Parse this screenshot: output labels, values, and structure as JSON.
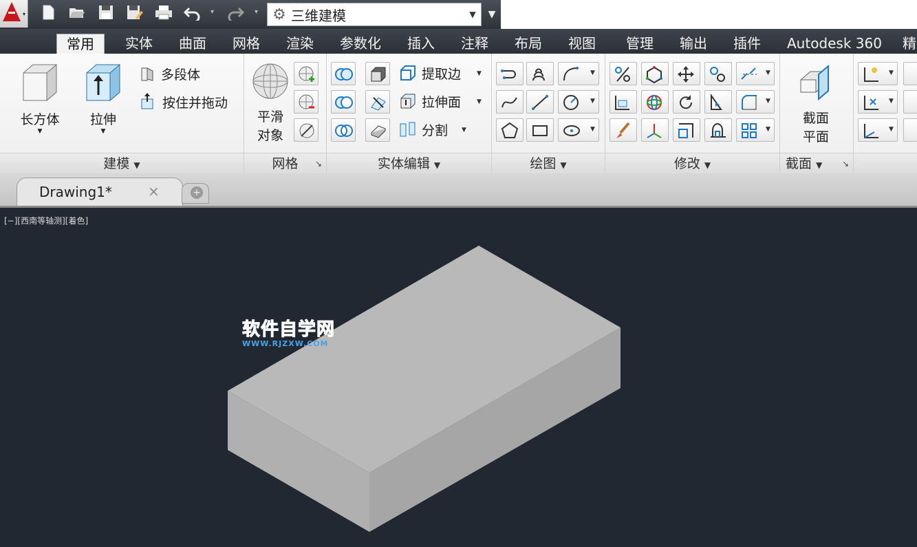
{
  "quick_access": {
    "workspace": "三维建模"
  },
  "tabs": [
    {
      "label": "常用",
      "active": true
    },
    {
      "label": "实体"
    },
    {
      "label": "曲面"
    },
    {
      "label": "网格"
    },
    {
      "label": "渲染"
    },
    {
      "label": "参数化"
    },
    {
      "label": "插入"
    },
    {
      "label": "注释"
    },
    {
      "label": "布局"
    },
    {
      "label": "视图"
    },
    {
      "label": "管理"
    },
    {
      "label": "输出"
    },
    {
      "label": "插件"
    },
    {
      "label": "Autodesk 360"
    },
    {
      "label": "精"
    }
  ],
  "ribbon": {
    "modeling": {
      "title": "建模",
      "box": "长方体",
      "extrude": "拉伸",
      "polysolid": "多段体",
      "presspull": "按住并拖动"
    },
    "mesh": {
      "title": "网格",
      "smooth_line1": "平滑",
      "smooth_line2": "对象"
    },
    "solid_edit": {
      "title": "实体编辑",
      "extract_edges": "提取边",
      "extrude_faces": "拉伸面",
      "separate": "分割"
    },
    "draw": {
      "title": "绘图"
    },
    "modify": {
      "title": "修改"
    },
    "section": {
      "title": "截面",
      "plane_line1": "截面",
      "plane_line2": "平面"
    }
  },
  "document": {
    "tab_name": "Drawing1*",
    "close_symbol": "×",
    "new_tab_symbol": "+"
  },
  "viewport": {
    "label": "[−][西南等轴测][着色]",
    "watermark_main": "软件自学网",
    "watermark_sub": "WWW.RJZXW.COM"
  },
  "colors": {
    "accent_blue": "#1e78c8",
    "background": "#222832",
    "box_top": "#b9b9b9",
    "box_left": "#b0b0b0",
    "box_right": "#a6a6a6"
  }
}
